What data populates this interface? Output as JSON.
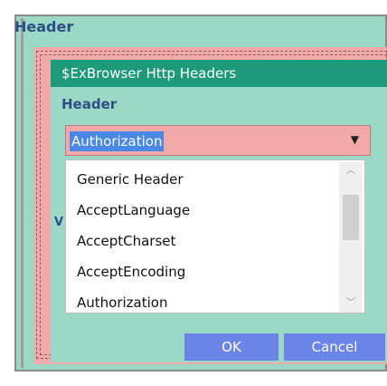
{
  "outer": {
    "title": "Header"
  },
  "dialog": {
    "title": "$ExBrowser Http Headers",
    "header_label": "Header",
    "combo": {
      "value": "Authorization"
    },
    "dropdown": {
      "items": [
        "Generic Header",
        "AcceptLanguage",
        "AcceptCharset",
        "AcceptEncoding",
        "Authorization"
      ]
    },
    "hidden_label_fragment": "V",
    "buttons": {
      "ok": "OK",
      "cancel": "Cancel"
    }
  },
  "icons": {
    "combo_arrow": "dropdown-arrow-icon",
    "scroll_up": "chevron-up-icon",
    "scroll_down": "chevron-down-icon"
  },
  "colors": {
    "panel": "#9cd8c6",
    "titlebar": "#1d9a7a",
    "frame": "#f2a9a9",
    "button": "#6a84e8",
    "selection": "#4a88e6"
  }
}
